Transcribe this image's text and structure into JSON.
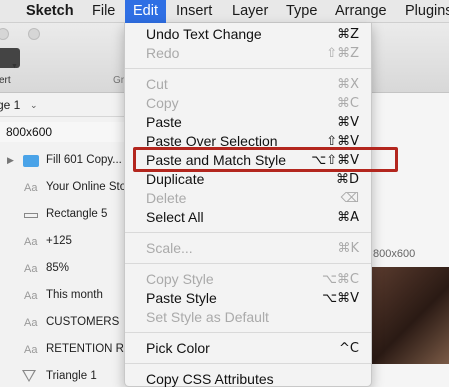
{
  "menubar": {
    "app_name": "Sketch",
    "items": [
      "File",
      "Edit",
      "Insert",
      "Layer",
      "Type",
      "Arrange",
      "Plugins"
    ],
    "active": "Edit"
  },
  "toolbar": {
    "insert_label": "sert",
    "group_label": "Gr"
  },
  "page_selector": {
    "label": "ge 1"
  },
  "artboard": {
    "name": "800x600"
  },
  "layers": [
    {
      "type": "group",
      "name": "Fill 601 Copy..."
    },
    {
      "type": "text",
      "name": "Your Online Sto"
    },
    {
      "type": "rectangle",
      "name": "Rectangle 5"
    },
    {
      "type": "text",
      "name": "+125"
    },
    {
      "type": "text",
      "name": "85%"
    },
    {
      "type": "text",
      "name": "This month"
    },
    {
      "type": "text",
      "name": "CUSTOMERS"
    },
    {
      "type": "text",
      "name": "RETENTION R..."
    },
    {
      "type": "shape",
      "name": "Triangle 1"
    }
  ],
  "layer_icons": {
    "text": "Aa"
  },
  "canvas": {
    "artboard_label": "800x600"
  },
  "edit_menu": {
    "items": [
      {
        "label": "Undo Text Change",
        "shortcut": "⌘Z",
        "enabled": true
      },
      {
        "label": "Redo",
        "shortcut": "⇧⌘Z",
        "enabled": false
      },
      {
        "label": "Cut",
        "shortcut": "⌘X",
        "enabled": false
      },
      {
        "label": "Copy",
        "shortcut": "⌘C",
        "enabled": false
      },
      {
        "label": "Paste",
        "shortcut": "⌘V",
        "enabled": true
      },
      {
        "label": "Paste Over Selection",
        "shortcut": "⇧⌘V",
        "enabled": true
      },
      {
        "label": "Paste and Match Style",
        "shortcut": "⌥⇧⌘V",
        "enabled": true
      },
      {
        "label": "Duplicate",
        "shortcut": "⌘D",
        "enabled": true
      },
      {
        "label": "Delete",
        "shortcut": "⌫",
        "enabled": false
      },
      {
        "label": "Select All",
        "shortcut": "⌘A",
        "enabled": true
      },
      {
        "label": "Scale...",
        "shortcut": "⌘K",
        "enabled": false
      },
      {
        "label": "Copy Style",
        "shortcut": "⌥⌘C",
        "enabled": false
      },
      {
        "label": "Paste Style",
        "shortcut": "⌥⌘V",
        "enabled": true
      },
      {
        "label": "Set Style as Default",
        "shortcut": "",
        "enabled": false
      },
      {
        "label": "Pick Color",
        "shortcut": "^C",
        "enabled": true
      },
      {
        "label": "Copy CSS Attributes",
        "shortcut": "",
        "enabled": true
      }
    ],
    "highlighted_item": "Paste and Match Style"
  },
  "colors": {
    "menu_active": "#2f6fe4",
    "highlight_box": "#b3261e",
    "folder": "#4aa3e8"
  }
}
